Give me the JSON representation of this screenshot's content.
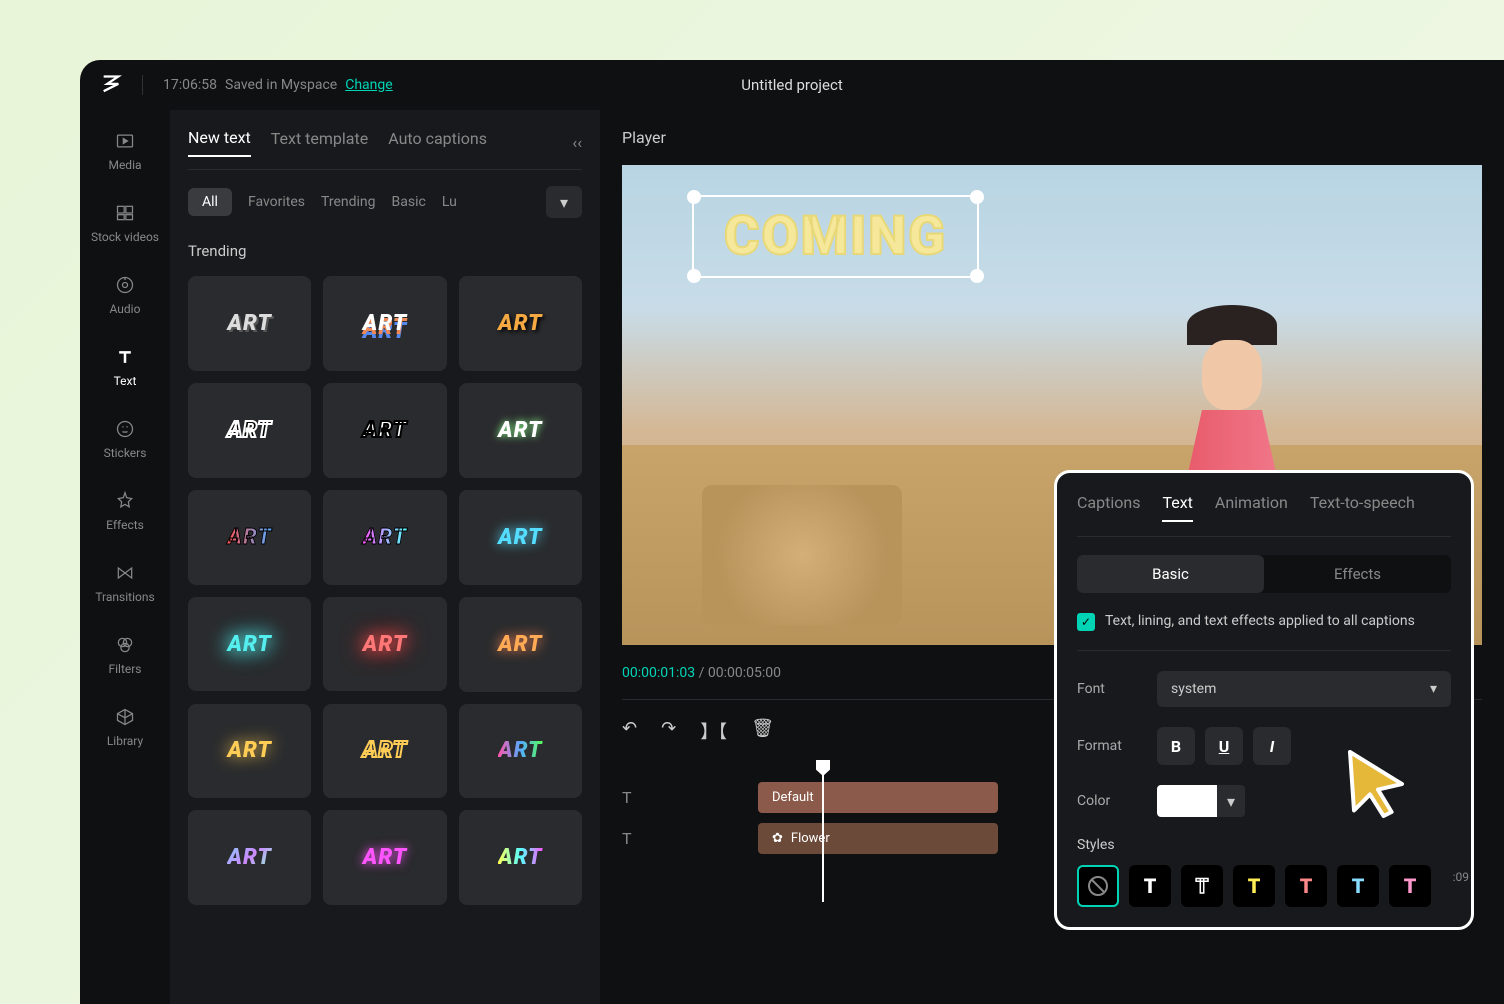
{
  "titlebar": {
    "timestamp": "17:06:58",
    "save_status": "Saved in Myspace",
    "change_link": "Change",
    "project_title": "Untitled project"
  },
  "left_rail": [
    {
      "id": "media",
      "label": "Media"
    },
    {
      "id": "stock-videos",
      "label": "Stock videos"
    },
    {
      "id": "audio",
      "label": "Audio"
    },
    {
      "id": "text",
      "label": "Text"
    },
    {
      "id": "stickers",
      "label": "Stickers"
    },
    {
      "id": "effects",
      "label": "Effects"
    },
    {
      "id": "transitions",
      "label": "Transitions"
    },
    {
      "id": "filters",
      "label": "Filters"
    },
    {
      "id": "library",
      "label": "Library"
    }
  ],
  "text_panel": {
    "tabs": [
      "New text",
      "Text template",
      "Auto captions"
    ],
    "filters": [
      "All",
      "Favorites",
      "Trending",
      "Basic",
      "Lu"
    ],
    "section": "Trending",
    "tile_text": "ART"
  },
  "player": {
    "header": "Player",
    "overlay_text": "COMING"
  },
  "timeline": {
    "current": "00:00:01:03",
    "total": "00:00:05:00",
    "clips": [
      "Default",
      "Flower"
    ],
    "marker": ":09"
  },
  "props": {
    "tabs": [
      "Captions",
      "Text",
      "Animation",
      "Text-to-speech"
    ],
    "subtabs": [
      "Basic",
      "Effects"
    ],
    "checkbox_label": "Text, lining, and text effects applied to all captions",
    "font_label": "Font",
    "font_value": "system",
    "format_label": "Format",
    "color_label": "Color",
    "styles_label": "Styles",
    "format_buttons": [
      "B",
      "U",
      "I"
    ]
  }
}
